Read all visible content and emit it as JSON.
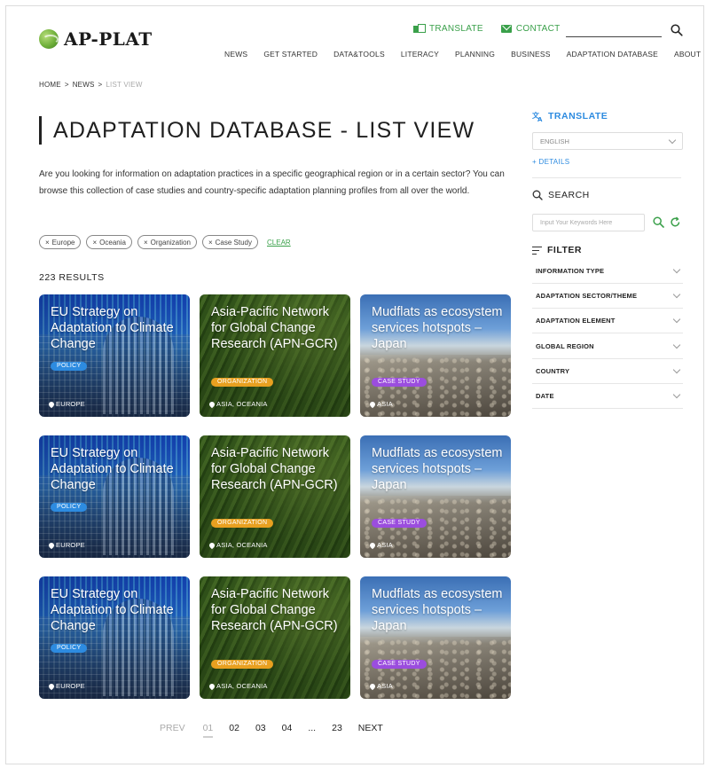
{
  "header": {
    "logo_text": "AP-PLAT",
    "top_links": {
      "translate": "TRANSLATE",
      "contact": "CONTACT"
    },
    "nav": [
      "NEWS",
      "GET STARTED",
      "DATA&TOOLS",
      "LITERACY",
      "PLANNING",
      "BUSINESS",
      "ADAPTATION DATABASE",
      "ABOUT"
    ]
  },
  "breadcrumb": {
    "home": "HOME",
    "sep1": ">",
    "news": "NEWS",
    "sep2": ">",
    "current": "LIST VIEW"
  },
  "page": {
    "title": "ADAPTATION DATABASE - LIST VIEW",
    "intro": "Are you looking for information on adaptation practices in a specific geographical region or in a certain sector? You can browse this collection of case studies and country-specific adaptation planning profiles from all over the world.",
    "chips": [
      "Europe",
      "Oceania",
      "Organization",
      "Case Study"
    ],
    "clear_label": "CLEAR",
    "results": "223 RESULTS"
  },
  "cards": [
    {
      "title": "EU Strategy on Adaptation to Climate Change",
      "badge": "POLICY",
      "location": "EUROPE"
    },
    {
      "title": "Asia-Pacific Network for Global Change Research (APN-GCR)",
      "badge": "ORGANIZATION",
      "location": "ASIA, OCEANIA"
    },
    {
      "title": "Mudflats as ecosystem services hotspots – Japan",
      "badge": "CASE STUDY",
      "location": "ASIA"
    },
    {
      "title": "EU Strategy on Adaptation to Climate Change",
      "badge": "POLICY",
      "location": "EUROPE"
    },
    {
      "title": "Asia-Pacific Network for Global Change Research (APN-GCR)",
      "badge": "ORGANIZATION",
      "location": "ASIA, OCEANIA"
    },
    {
      "title": "Mudflats as ecosystem services hotspots – Japan",
      "badge": "CASE STUDY",
      "location": "ASIA"
    },
    {
      "title": "EU Strategy on Adaptation to Climate Change",
      "badge": "POLICY",
      "location": "EUROPE"
    },
    {
      "title": "Asia-Pacific Network for Global Change Research (APN-GCR)",
      "badge": "ORGANIZATION",
      "location": "ASIA, OCEANIA"
    },
    {
      "title": "Mudflats as ecosystem services hotspots – Japan",
      "badge": "CASE STUDY",
      "location": "ASIA"
    }
  ],
  "pagination": {
    "prev": "PREV",
    "pages": [
      "01",
      "02",
      "03",
      "04",
      "...",
      "23"
    ],
    "next": "NEXT",
    "active": "01"
  },
  "sidebar": {
    "translate_title": "TRANSLATE",
    "language_value": "ENGLISH",
    "details_label": "+ DETAILS",
    "search_title": "SEARCH",
    "search_placeholder": "Input Your Keywords Here",
    "filter_title": "FILTER",
    "filters": [
      "INFORMATION TYPE",
      "ADAPTATION SECTOR/THEME",
      "ADAPTATION ELEMENT",
      "GLOBAL REGION",
      "COUNTRY",
      "DATE"
    ]
  },
  "colors": {
    "brand_green": "#3aa04a",
    "link_blue": "#2d8be0",
    "policy": "#2d8be0",
    "organization": "#e8a020",
    "case_study": "#9b4dde"
  },
  "icons": [
    "translate-icon",
    "mail-icon",
    "search-icon",
    "pin-icon",
    "chevron-down-icon",
    "filter-icon",
    "reset-icon"
  ]
}
